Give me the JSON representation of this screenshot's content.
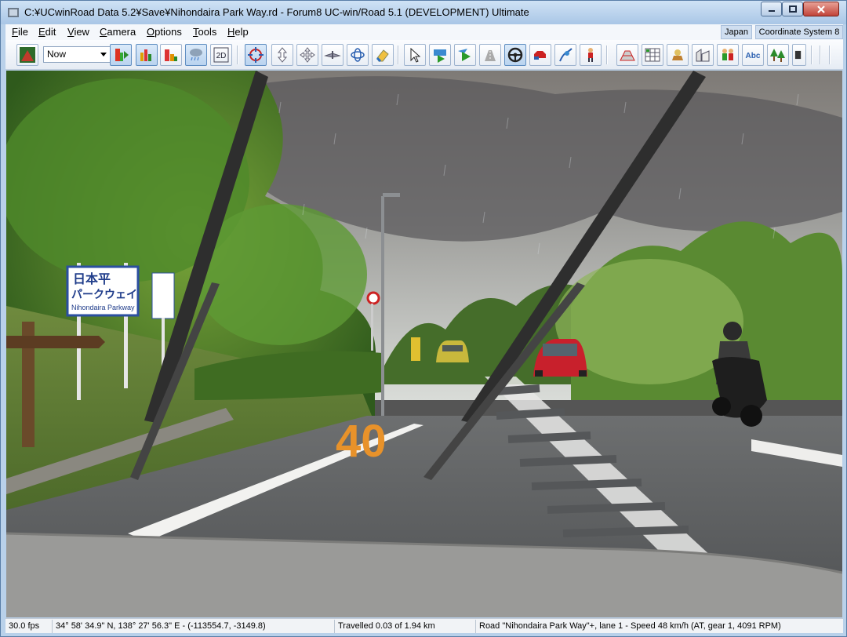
{
  "window": {
    "title": "C:¥UCwinRoad Data 5.2¥Save¥Nihondaira Park Way.rd - Forum8 UC-win/Road 5.1 (DEVELOPMENT) Ultimate"
  },
  "menu": {
    "items": [
      "File",
      "Edit",
      "View",
      "Camera",
      "Options",
      "Tools",
      "Help"
    ],
    "region": "Japan",
    "coordinate_system": "Coordinate System 8"
  },
  "toolbar": {
    "time_of_day": "Now",
    "view_2d_label": "2D",
    "text_tool_label": "Abc",
    "icons": [
      "landscape-icon",
      "traffic-light-icon",
      "bar-chart-icon",
      "bar-chart-red-icon",
      "rain-cloud-icon",
      "view-2d-icon",
      "rotate-view-icon",
      "vertical-move-icon",
      "pan-icon",
      "fly-icon",
      "orbit-icon",
      "eraser-icon",
      "pointer-icon",
      "drive-play-icon",
      "play-icon",
      "road-select-icon",
      "steering-wheel-icon",
      "vehicle-icon",
      "walk-path-icon",
      "pedestrian-icon",
      "road-section-icon",
      "grid-table-icon",
      "model-icon",
      "building-icon",
      "people-icon",
      "text-icon",
      "trees-icon",
      "more-icon"
    ]
  },
  "scene": {
    "sign_main_line1": "日本平",
    "sign_main_line2": "パークウェイ",
    "sign_main_line3": "Nihondaira Parkway",
    "road_marking": "40"
  },
  "statusbar": {
    "fps": "30.0 fps",
    "position": "34°  58' 34.9\" N, 138°  27' 56.3\" E  -  (-113554.7, -3149.8)",
    "travelled": "Travelled 0.03 of 1.94 km",
    "driving": "Road \"Nihondaira Park Way\"+, lane 1 - Speed 48 km/h (AT, gear 1, 4091 RPM)"
  }
}
